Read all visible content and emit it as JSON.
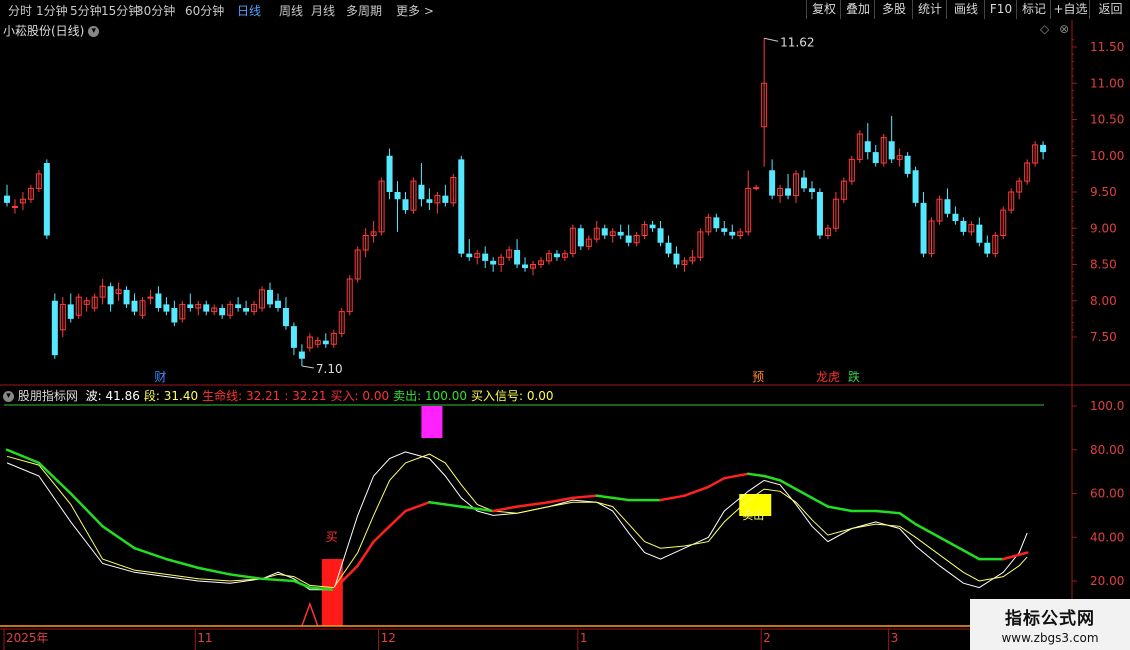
{
  "periods": [
    "分时",
    "1分钟",
    "5分钟",
    "15分钟",
    "30分钟",
    "60分钟",
    "日线",
    "周线",
    "月线",
    "多周期",
    "更多 >"
  ],
  "active_period": "日线",
  "tools": [
    "复权",
    "叠加",
    "多股",
    "统计",
    "画线",
    "F10",
    "标记",
    "+自选",
    "返回"
  ],
  "stock_title": "小菘股份(日线)",
  "price_axis": [
    "11.50",
    "11.00",
    "10.50",
    "10.00",
    "9.50",
    "9.00",
    "8.50",
    "8.00",
    "7.50"
  ],
  "high_label": "11.62",
  "low_label": "7.10",
  "event_markers": [
    {
      "text": "财",
      "color": "#3d8bff",
      "idx": 19
    },
    {
      "text": "预",
      "color": "#ff8a2a",
      "idx": 94
    },
    {
      "text": "龙虎",
      "color": "#ff3333",
      "idx": 102
    },
    {
      "text": "跌",
      "color": "#35d050",
      "idx": 106
    }
  ],
  "indicator": {
    "name": "股朋指标网",
    "values": [
      {
        "label": "波:",
        "value": "41.86",
        "color": "#ffffff"
      },
      {
        "label": "段:",
        "value": "31.40",
        "color": "#ffff55"
      },
      {
        "label": "生命线:",
        "value": "32.21",
        "color": "#ff3333"
      },
      {
        "label": ":",
        "value": "32.21",
        "color": "#ff3333"
      },
      {
        "label": "买入:",
        "value": "0.00",
        "color": "#ff3333"
      },
      {
        "label": "卖出:",
        "value": "100.00",
        "color": "#33e033"
      },
      {
        "label": "买入信号:",
        "value": "0.00",
        "color": "#ffff55"
      }
    ],
    "axis": [
      "100.0",
      "80.00",
      "60.00",
      "40.00",
      "20.00"
    ],
    "buy_text": "买",
    "sell_box_text": "卖出"
  },
  "date_axis": [
    {
      "label": "2025年",
      "idx": 0
    },
    {
      "label": "11",
      "idx": 24
    },
    {
      "label": "12",
      "idx": 47
    },
    {
      "label": "1",
      "idx": 72
    },
    {
      "label": "2",
      "idx": 95
    },
    {
      "label": "3",
      "idx": 111
    }
  ],
  "colors": {
    "up": "#ff3b3b",
    "down": "#55e8ff",
    "axis": "#a01818",
    "bg": "#000000"
  },
  "chart_data": {
    "type": "candlestick",
    "ohlc": [
      [
        9.45,
        9.6,
        9.3,
        9.35
      ],
      [
        9.3,
        9.4,
        9.2,
        9.3
      ],
      [
        9.35,
        9.5,
        9.25,
        9.4
      ],
      [
        9.4,
        9.6,
        9.35,
        9.55
      ],
      [
        9.55,
        9.8,
        9.5,
        9.75
      ],
      [
        9.9,
        9.95,
        8.85,
        8.9
      ],
      [
        8.0,
        8.1,
        7.2,
        7.25
      ],
      [
        7.6,
        8.05,
        7.5,
        7.95
      ],
      [
        7.95,
        8.1,
        7.7,
        7.75
      ],
      [
        7.8,
        8.1,
        7.75,
        8.05
      ],
      [
        7.95,
        8.05,
        7.85,
        8.0
      ],
      [
        7.9,
        8.1,
        7.85,
        8.05
      ],
      [
        8.05,
        8.3,
        7.95,
        8.2
      ],
      [
        8.2,
        8.25,
        7.85,
        7.95
      ],
      [
        8.1,
        8.25,
        8.0,
        8.15
      ],
      [
        8.15,
        8.2,
        7.9,
        7.95
      ],
      [
        8.0,
        8.1,
        7.8,
        7.85
      ],
      [
        7.8,
        8.05,
        7.75,
        8.0
      ],
      [
        8.05,
        8.15,
        7.95,
        8.05
      ],
      [
        8.1,
        8.2,
        7.85,
        7.9
      ],
      [
        7.95,
        8.05,
        7.8,
        7.85
      ],
      [
        7.9,
        8.0,
        7.65,
        7.7
      ],
      [
        7.75,
        8.0,
        7.7,
        7.95
      ],
      [
        7.95,
        8.1,
        7.85,
        7.9
      ],
      [
        7.9,
        8.0,
        7.8,
        7.95
      ],
      [
        7.95,
        8.0,
        7.8,
        7.85
      ],
      [
        7.85,
        7.95,
        7.8,
        7.9
      ],
      [
        7.9,
        7.95,
        7.75,
        7.8
      ],
      [
        7.8,
        8.0,
        7.75,
        7.95
      ],
      [
        7.95,
        8.05,
        7.85,
        7.9
      ],
      [
        7.9,
        8.0,
        7.8,
        7.85
      ],
      [
        7.85,
        8.0,
        7.8,
        7.95
      ],
      [
        7.9,
        8.2,
        7.85,
        8.15
      ],
      [
        8.15,
        8.25,
        7.9,
        7.95
      ],
      [
        8.0,
        8.1,
        7.85,
        7.9
      ],
      [
        7.9,
        8.05,
        7.6,
        7.65
      ],
      [
        7.65,
        7.7,
        7.25,
        7.35
      ],
      [
        7.3,
        7.4,
        7.1,
        7.2
      ],
      [
        7.35,
        7.55,
        7.3,
        7.5
      ],
      [
        7.4,
        7.5,
        7.35,
        7.45
      ],
      [
        7.45,
        7.55,
        7.35,
        7.4
      ],
      [
        7.4,
        7.6,
        7.35,
        7.55
      ],
      [
        7.55,
        7.9,
        7.5,
        7.85
      ],
      [
        7.85,
        8.35,
        7.8,
        8.3
      ],
      [
        8.3,
        8.75,
        8.25,
        8.7
      ],
      [
        8.7,
        9.0,
        8.6,
        8.9
      ],
      [
        8.9,
        9.1,
        8.8,
        8.95
      ],
      [
        8.95,
        9.7,
        8.9,
        9.65
      ],
      [
        10.0,
        10.1,
        9.4,
        9.5
      ],
      [
        9.5,
        9.65,
        8.95,
        9.4
      ],
      [
        9.4,
        9.5,
        9.2,
        9.25
      ],
      [
        9.25,
        9.7,
        9.2,
        9.65
      ],
      [
        9.6,
        9.9,
        9.3,
        9.4
      ],
      [
        9.4,
        9.55,
        9.25,
        9.35
      ],
      [
        9.35,
        9.5,
        9.2,
        9.45
      ],
      [
        9.45,
        9.6,
        9.3,
        9.35
      ],
      [
        9.35,
        9.75,
        9.3,
        9.7
      ],
      [
        9.95,
        10.0,
        8.6,
        8.65
      ],
      [
        8.65,
        8.85,
        8.55,
        8.6
      ],
      [
        8.6,
        8.7,
        8.5,
        8.65
      ],
      [
        8.65,
        8.75,
        8.45,
        8.55
      ],
      [
        8.55,
        8.6,
        8.4,
        8.5
      ],
      [
        8.5,
        8.65,
        8.4,
        8.6
      ],
      [
        8.6,
        8.75,
        8.55,
        8.7
      ],
      [
        8.7,
        8.85,
        8.45,
        8.5
      ],
      [
        8.5,
        8.6,
        8.4,
        8.45
      ],
      [
        8.45,
        8.55,
        8.35,
        8.5
      ],
      [
        8.5,
        8.6,
        8.45,
        8.55
      ],
      [
        8.55,
        8.7,
        8.5,
        8.65
      ],
      [
        8.65,
        8.7,
        8.55,
        8.6
      ],
      [
        8.6,
        8.7,
        8.55,
        8.65
      ],
      [
        8.65,
        9.05,
        8.6,
        9.0
      ],
      [
        9.0,
        9.05,
        8.7,
        8.75
      ],
      [
        8.75,
        8.9,
        8.7,
        8.85
      ],
      [
        8.85,
        9.1,
        8.8,
        9.0
      ],
      [
        9.0,
        9.05,
        8.85,
        8.9
      ],
      [
        8.9,
        9.0,
        8.8,
        8.95
      ],
      [
        8.95,
        9.05,
        8.85,
        8.9
      ],
      [
        8.9,
        9.05,
        8.75,
        8.8
      ],
      [
        8.8,
        8.95,
        8.75,
        8.9
      ],
      [
        8.9,
        9.1,
        8.85,
        9.05
      ],
      [
        9.05,
        9.1,
        8.95,
        9.0
      ],
      [
        9.0,
        9.1,
        8.75,
        8.8
      ],
      [
        8.8,
        8.9,
        8.6,
        8.65
      ],
      [
        8.65,
        8.75,
        8.45,
        8.5
      ],
      [
        8.5,
        8.6,
        8.4,
        8.55
      ],
      [
        8.55,
        8.7,
        8.5,
        8.6
      ],
      [
        8.6,
        9.0,
        8.55,
        8.95
      ],
      [
        8.95,
        9.2,
        8.9,
        9.15
      ],
      [
        9.15,
        9.2,
        8.95,
        9.0
      ],
      [
        9.0,
        9.1,
        8.9,
        8.95
      ],
      [
        8.95,
        9.05,
        8.85,
        8.9
      ],
      [
        8.9,
        9.0,
        8.85,
        8.95
      ],
      [
        8.95,
        9.8,
        8.9,
        9.55
      ],
      [
        9.55,
        9.6,
        9.52,
        9.56
      ],
      [
        10.4,
        11.62,
        9.85,
        11.0
      ],
      [
        9.8,
        9.95,
        9.4,
        9.45
      ],
      [
        9.45,
        9.6,
        9.35,
        9.55
      ],
      [
        9.55,
        9.75,
        9.4,
        9.45
      ],
      [
        9.45,
        9.8,
        9.35,
        9.75
      ],
      [
        9.7,
        9.8,
        9.5,
        9.55
      ],
      [
        9.55,
        9.65,
        9.4,
        9.5
      ],
      [
        9.5,
        9.55,
        8.85,
        8.9
      ],
      [
        8.9,
        9.05,
        8.85,
        9.0
      ],
      [
        9.0,
        9.5,
        8.95,
        9.4
      ],
      [
        9.4,
        9.7,
        9.35,
        9.65
      ],
      [
        9.65,
        10.0,
        9.6,
        9.95
      ],
      [
        9.95,
        10.35,
        9.9,
        10.3
      ],
      [
        10.2,
        10.45,
        9.95,
        10.05
      ],
      [
        10.05,
        10.15,
        9.85,
        9.9
      ],
      [
        9.9,
        10.3,
        9.85,
        10.25
      ],
      [
        10.2,
        10.55,
        9.9,
        9.95
      ],
      [
        9.95,
        10.1,
        9.85,
        10.0
      ],
      [
        10.0,
        10.05,
        9.7,
        9.75
      ],
      [
        9.8,
        9.85,
        9.3,
        9.35
      ],
      [
        9.35,
        9.5,
        8.6,
        8.65
      ],
      [
        8.65,
        9.15,
        8.6,
        9.1
      ],
      [
        9.1,
        9.45,
        9.05,
        9.4
      ],
      [
        9.4,
        9.55,
        9.15,
        9.2
      ],
      [
        9.2,
        9.3,
        9.05,
        9.1
      ],
      [
        9.1,
        9.15,
        8.9,
        8.95
      ],
      [
        8.95,
        9.1,
        8.9,
        9.05
      ],
      [
        9.05,
        9.15,
        8.75,
        8.8
      ],
      [
        8.8,
        8.9,
        8.6,
        8.65
      ],
      [
        8.65,
        8.95,
        8.6,
        8.9
      ],
      [
        8.9,
        9.3,
        8.85,
        9.25
      ],
      [
        9.25,
        9.55,
        9.2,
        9.5
      ],
      [
        9.5,
        9.7,
        9.4,
        9.65
      ],
      [
        9.65,
        9.95,
        9.6,
        9.9
      ],
      [
        9.9,
        10.2,
        9.85,
        10.15
      ],
      [
        10.15,
        10.2,
        9.95,
        10.05
      ]
    ],
    "price_range": [
      7.0,
      11.9
    ],
    "indicator_range": [
      0,
      105
    ],
    "indicator_series": {
      "波": [
        [
          0,
          74
        ],
        [
          4,
          68
        ],
        [
          8,
          47
        ],
        [
          12,
          28
        ],
        [
          16,
          24
        ],
        [
          20,
          22
        ],
        [
          24,
          20
        ],
        [
          28,
          19
        ],
        [
          32,
          21
        ],
        [
          34,
          24
        ],
        [
          36,
          21
        ],
        [
          38,
          16
        ],
        [
          41,
          16
        ],
        [
          44,
          50
        ],
        [
          46,
          68
        ],
        [
          48,
          76
        ],
        [
          50,
          79
        ],
        [
          53,
          76
        ],
        [
          55,
          68
        ],
        [
          57,
          58
        ],
        [
          59,
          52
        ],
        [
          61,
          50
        ],
        [
          64,
          51
        ],
        [
          68,
          54
        ],
        [
          71,
          57
        ],
        [
          74,
          56
        ],
        [
          76,
          52
        ],
        [
          78,
          42
        ],
        [
          80,
          33
        ],
        [
          82,
          30
        ],
        [
          85,
          35
        ],
        [
          88,
          40
        ],
        [
          90,
          52
        ],
        [
          93,
          61
        ],
        [
          95,
          66
        ],
        [
          97,
          64
        ],
        [
          99,
          55
        ],
        [
          101,
          45
        ],
        [
          103,
          38
        ],
        [
          106,
          44
        ],
        [
          109,
          47
        ],
        [
          112,
          44
        ],
        [
          114,
          36
        ],
        [
          117,
          27
        ],
        [
          120,
          19
        ],
        [
          122,
          17
        ],
        [
          125,
          24
        ],
        [
          127,
          33
        ],
        [
          128,
          42
        ]
      ],
      "段": [
        [
          0,
          77
        ],
        [
          4,
          73
        ],
        [
          8,
          55
        ],
        [
          12,
          30
        ],
        [
          16,
          25
        ],
        [
          20,
          23
        ],
        [
          24,
          21
        ],
        [
          28,
          20
        ],
        [
          32,
          21
        ],
        [
          34,
          23
        ],
        [
          36,
          22
        ],
        [
          38,
          18
        ],
        [
          41,
          17
        ],
        [
          44,
          33
        ],
        [
          46,
          50
        ],
        [
          48,
          66
        ],
        [
          50,
          74
        ],
        [
          53,
          78
        ],
        [
          55,
          74
        ],
        [
          57,
          64
        ],
        [
          59,
          55
        ],
        [
          61,
          52
        ],
        [
          64,
          51
        ],
        [
          68,
          54
        ],
        [
          71,
          56
        ],
        [
          74,
          56
        ],
        [
          76,
          54
        ],
        [
          78,
          46
        ],
        [
          80,
          38
        ],
        [
          82,
          35
        ],
        [
          85,
          36
        ],
        [
          88,
          38
        ],
        [
          90,
          47
        ],
        [
          93,
          57
        ],
        [
          95,
          62
        ],
        [
          97,
          61
        ],
        [
          99,
          56
        ],
        [
          101,
          48
        ],
        [
          103,
          41
        ],
        [
          106,
          44
        ],
        [
          109,
          46
        ],
        [
          112,
          45
        ],
        [
          114,
          40
        ],
        [
          117,
          32
        ],
        [
          120,
          24
        ],
        [
          122,
          20
        ],
        [
          125,
          22
        ],
        [
          127,
          27
        ],
        [
          128,
          31
        ]
      ],
      "生命线": [
        [
          0,
          80
        ],
        [
          4,
          74
        ],
        [
          8,
          60
        ],
        [
          12,
          45
        ],
        [
          16,
          35
        ],
        [
          20,
          30
        ],
        [
          24,
          26
        ],
        [
          28,
          23
        ],
        [
          32,
          21
        ],
        [
          36,
          20
        ],
        [
          38,
          17
        ],
        [
          41,
          16
        ],
        [
          44,
          27
        ],
        [
          46,
          38
        ],
        [
          48,
          45
        ],
        [
          50,
          52
        ],
        [
          53,
          56
        ],
        [
          55,
          55
        ],
        [
          57,
          54
        ],
        [
          59,
          53
        ],
        [
          61,
          52
        ],
        [
          64,
          54
        ],
        [
          68,
          56
        ],
        [
          71,
          58
        ],
        [
          74,
          59
        ],
        [
          76,
          58
        ],
        [
          78,
          57
        ],
        [
          80,
          57
        ],
        [
          82,
          57
        ],
        [
          85,
          59
        ],
        [
          88,
          63
        ],
        [
          90,
          67
        ],
        [
          93,
          69
        ],
        [
          95,
          68
        ],
        [
          97,
          66
        ],
        [
          99,
          62
        ],
        [
          101,
          58
        ],
        [
          103,
          54
        ],
        [
          106,
          52
        ],
        [
          109,
          52
        ],
        [
          112,
          51
        ],
        [
          114,
          46
        ],
        [
          117,
          40
        ],
        [
          120,
          34
        ],
        [
          122,
          30
        ],
        [
          125,
          30
        ],
        [
          127,
          32
        ],
        [
          128,
          33
        ]
      ]
    },
    "buy_marker_idx": 40,
    "sell_marker_idx": 53,
    "signal_box_idx": 92
  }
}
